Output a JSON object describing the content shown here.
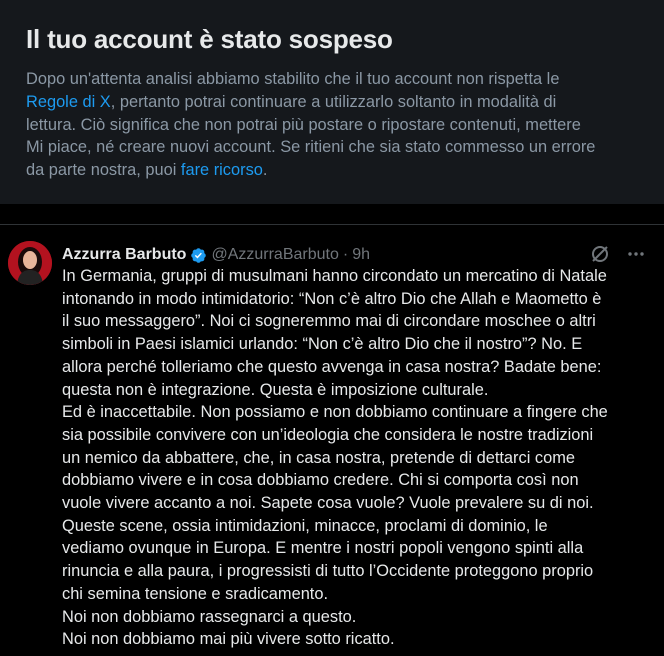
{
  "notice": {
    "title": "Il tuo account è stato sospeso",
    "text_1": "Dopo un'attenta analisi abbiamo stabilito che il tuo account non rispetta le",
    "rules_link": "Regole di X",
    "text_2": ", pertanto potrai continuare a utilizzarlo soltanto in modalità di",
    "text_3": "lettura. Ciò significa che non potrai più postare o ripostare contenuti, mettere",
    "text_4": "Mi piace, né creare nuovi account. Se ritieni che sia stato commesso un errore",
    "text_5": "da parte nostra, puoi ",
    "appeal_link": "fare ricorso",
    "text_6": "."
  },
  "tweet": {
    "author_name": "Azzurra Barbuto",
    "handle": "@AzzurraBarbuto",
    "separator": "·",
    "time": "9h",
    "lines": [
      "In Germania, gruppi di musulmani hanno circondato un mercatino di Natale",
      "intonando in modo intimidatorio: “Non c’è altro Dio che Allah e Maometto è",
      "il suo messaggero”. Noi ci sogneremmo mai di circondare moschee o altri",
      "simboli in Paesi islamici urlando: “Non c’è altro Dio che il nostro”? No. E",
      "allora perché tolleriamo che questo avvenga in casa nostra? Badate bene:",
      "questa non è integrazione. Questa è imposizione culturale.",
      "Ed è inaccettabile. Non possiamo e non dobbiamo continuare a fingere che",
      "sia possibile convivere con un’ideologia che considera le nostre tradizioni",
      "un nemico da abbattere, che, in casa nostra, pretende di dettarci come",
      "dobbiamo vivere e in cosa dobbiamo credere. Chi si comporta così non",
      "vuole vivere accanto a noi. Sapete cosa vuole? Vuole prevalere su di noi.",
      "Queste scene, ossia intimidazioni, minacce, proclami di dominio, le",
      "vediamo ovunque in Europa. E mentre i nostri popoli vengono spinti alla",
      "rinuncia e alla paura, i progressisti di tutto l’Occidente proteggono proprio",
      "chi semina tensione e sradicamento.",
      "Noi non dobbiamo rassegnarci a questo.",
      "Noi non dobbiamo mai più vivere sotto ricatto."
    ]
  },
  "colors": {
    "background": "#000000",
    "notice_background": "#15181c",
    "link": "#1d9bf0",
    "verified": "#1d9bf0",
    "secondary_text": "#71767b"
  },
  "icons": [
    "verified-badge-icon",
    "grok-icon",
    "more-icon"
  ]
}
